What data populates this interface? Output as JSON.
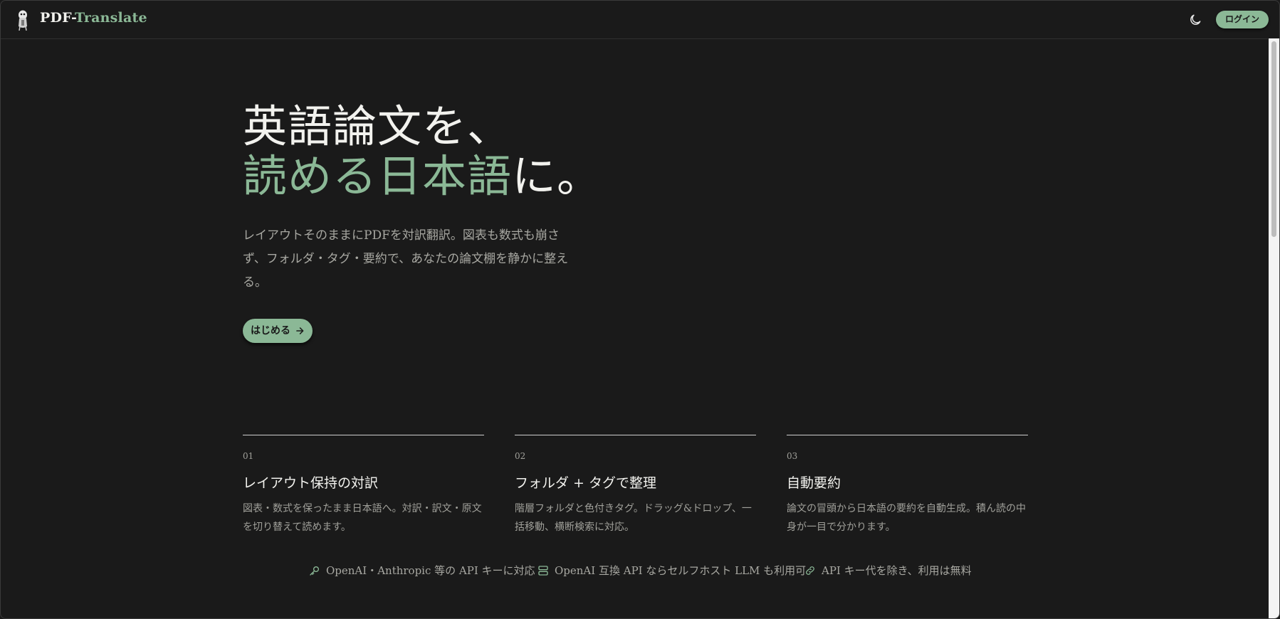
{
  "app": {
    "brand_main": "PDF-",
    "brand_accent": "Translate",
    "login_label": "ログイン",
    "accent_color": "#8bb896",
    "background_color": "#1a1a1a"
  },
  "hero": {
    "title_line1": "英語論文を、",
    "title_line2_accent": "読める日本語",
    "title_line2_rest": "に。",
    "description": "レイアウトそのままにPDFを対訳翻訳。図表も数式も崩さず、フォルダ・タグ・要約で、あなたの論文棚を静かに整える。",
    "cta_label": "はじめる"
  },
  "features": [
    {
      "number": "01",
      "title": "レイアウト保持の対訳",
      "description": "図表・数式を保ったまま日本語へ。対訳・訳文・原文を切り替えて読めます。"
    },
    {
      "number": "02",
      "title": "フォルダ + タグで整理",
      "description": "階層フォルダと色付きタグ。ドラッグ&ドロップ、一括移動、横断検索に対応。"
    },
    {
      "number": "03",
      "title": "自動要約",
      "description": "論文の冒頭から日本語の要約を自動生成。積ん読の中身が一目で分かります。"
    }
  ],
  "notes": [
    {
      "icon": "key-icon",
      "text": "OpenAI・Anthropic 等の API キーに対応"
    },
    {
      "icon": "server-icon",
      "text": "OpenAI 互換 API ならセルフホスト LLM も利用可"
    },
    {
      "icon": "link-icon",
      "text": "API キー代を除き、利用は無料"
    }
  ]
}
